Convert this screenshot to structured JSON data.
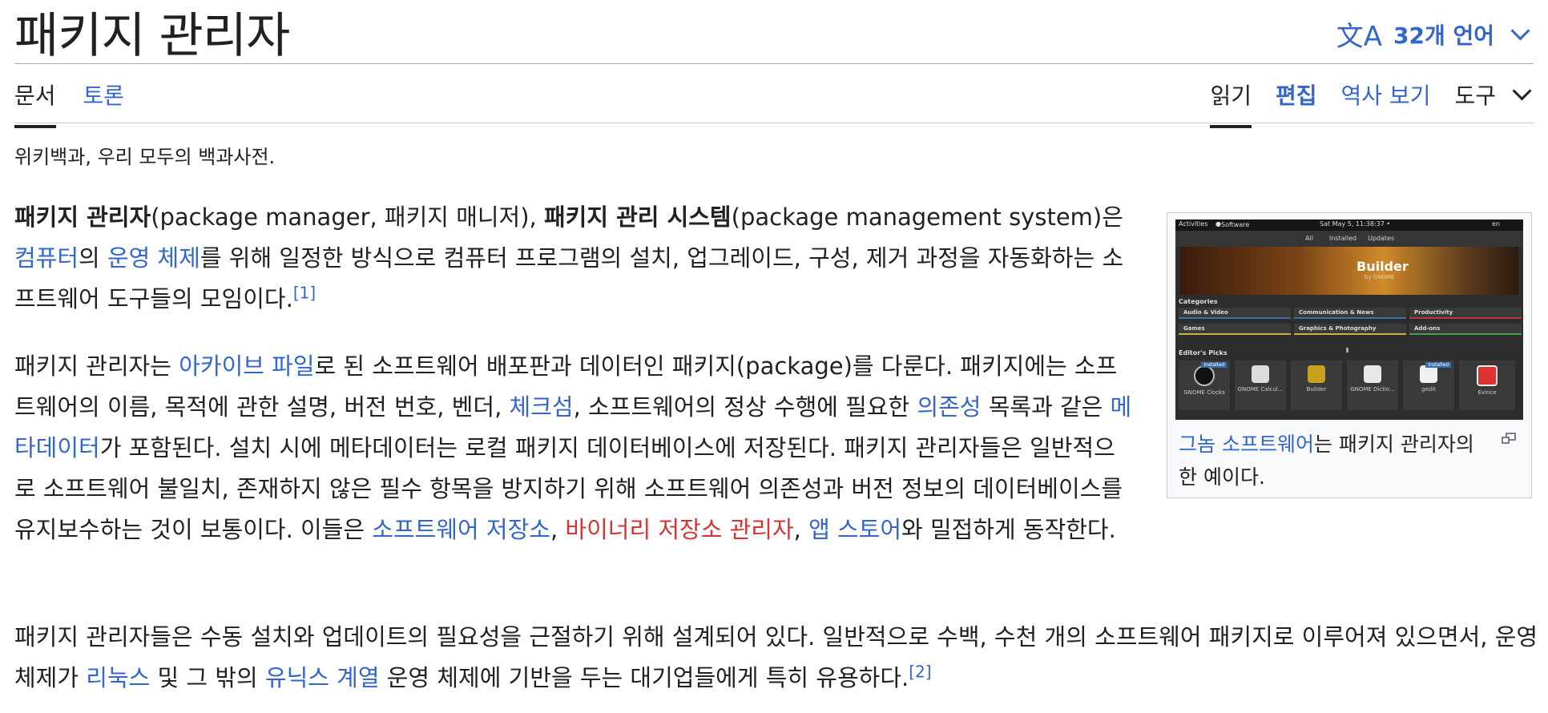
{
  "page": {
    "title": "패키지 관리자",
    "languages": "32개 언어",
    "tagline": "위키백과, 우리 모두의 백과사전."
  },
  "tabs_left": [
    {
      "label": "문서",
      "selected": true
    },
    {
      "label": "토론",
      "selected": false
    }
  ],
  "tabs_right": [
    {
      "label": "읽기",
      "selected": true
    },
    {
      "label": "편집"
    },
    {
      "label": "역사 보기"
    },
    {
      "label": "도구"
    }
  ],
  "paragraphs": {
    "p1": {
      "b1": "패키지 관리자",
      "t1": "(package manager, 패키지 매니저), ",
      "b2": "패키지 관리 시스템",
      "t2": "(package management system)은 ",
      "l1": "컴퓨터",
      "t3": "의 ",
      "l2": "운영 체제",
      "t4": "를 위해 일정한 방식으로 컴퓨터 프로그램의 설치, 업그레이드, 구성, 제거 과정을 자동화하는 소프트웨어 도구들의 모임이다.",
      "ref": "[1]"
    },
    "p2": {
      "t1": "패키지 관리자는 ",
      "l1": "아카이브 파일",
      "t2": "로 된 소프트웨어 배포판과 데이터인 패키지(package)를 다룬다. 패키지에는 소프트웨어의 이름, 목적에 관한 설명, 버전 번호, 벤더, ",
      "l2": "체크섬",
      "t3": ", 소프트웨어의 정상 수행에 필요한 ",
      "l3": "의존성",
      "t4": " 목록과 같은 ",
      "l4": "메타데이터",
      "t5": "가 포함된다. 설치 시에 메타데이터는 로컬 패키지 데이터베이스에 저장된다. 패키지 관리자들은 일반적으로 소프트웨어 불일치, 존재하지 않은 필수 항목을 방지하기 위해 소프트웨어 의존성과 버전 정보의 데이터베이스를 유지보수하는 것이 보통이다. 이들은 ",
      "l5": "소프트웨어 저장소",
      "t6": ", ",
      "l6": "바이너리 저장소 관리자",
      "t7": ", ",
      "l7": "앱 스토어",
      "t8": "와 밀접하게 동작한다."
    },
    "p3": {
      "t1": "패키지 관리자들은 수동 설치와 업데이트의 필요성을 근절하기 위해 설계되어 있다. 일반적으로 수백, 수천 개의 소프트웨어 패키지로 이루어져 있으면서, 운영 체제가 ",
      "l1": "리눅스",
      "t2": " 및 그 밖의 ",
      "l2": "유닉스 계열",
      "t3": " 운영 체제에 기반을 두는 대기업들에게 특히 유용하다.",
      "ref": "[2]"
    }
  },
  "figure": {
    "caption_link": "그놈 소프트웨어",
    "caption_rest": "는 패키지 관리자의 한 예이다.",
    "screenshot": {
      "topbar_left": "Activities",
      "topbar_app": "Software",
      "topbar_time": "Sat May 5, 11:38:37 •",
      "topbar_right": "en",
      "tab_all": "All",
      "tab_installed": "Installed",
      "tab_updates": "Updates",
      "banner_title": "Builder",
      "banner_sub": "by GNOME",
      "categories_heading": "Categories",
      "categories": [
        "Audio & Video",
        "Communication & News",
        "Productivity",
        "Games",
        "Graphics & Photography",
        "Add-ons"
      ],
      "editors_heading": "Editor's Picks",
      "apps": [
        {
          "name": "GNOME Clocks",
          "installed": true
        },
        {
          "name": "GNOME Calcul...",
          "installed": false
        },
        {
          "name": "Builder",
          "installed": false
        },
        {
          "name": "GNOME Dictio...",
          "installed": false
        },
        {
          "name": "gedit",
          "installed": true
        },
        {
          "name": "Evince",
          "installed": false
        }
      ],
      "installed_badge": "Installed"
    }
  },
  "colors": {
    "link": "#3366cc",
    "redlink": "#d73333",
    "text": "#202122"
  }
}
